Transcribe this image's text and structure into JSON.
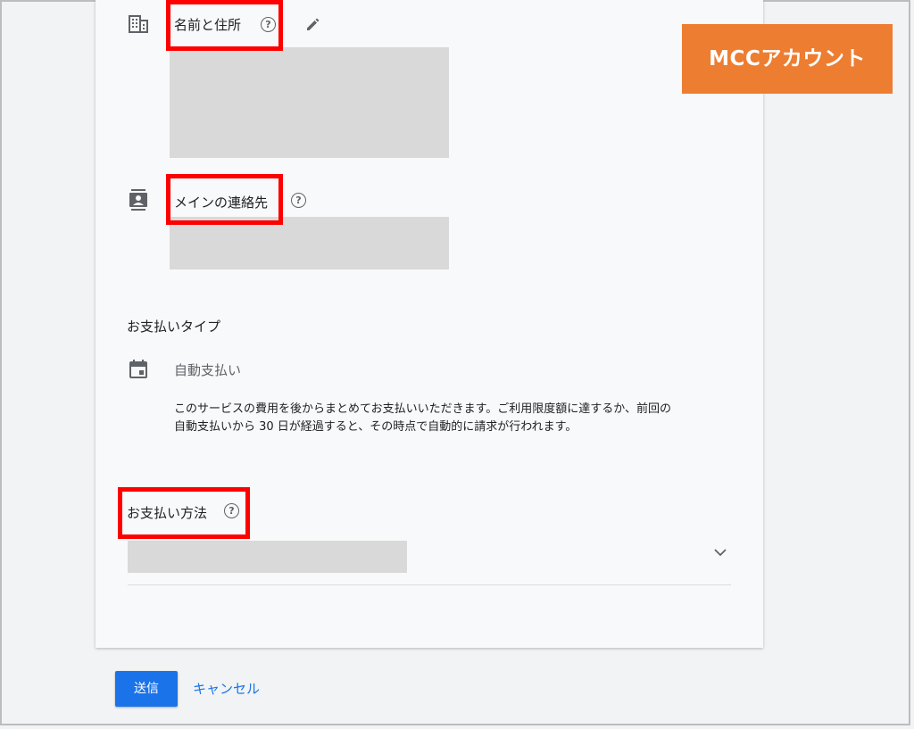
{
  "annotation": {
    "badge_label": "MCCアカウント",
    "badge_color": "#ed7d31",
    "highlight_color": "#ff0000"
  },
  "sections": {
    "name_address": {
      "label": "名前と住所",
      "icon": "building-icon",
      "help_glyph": "?",
      "edit_icon": "pencil-icon"
    },
    "main_contact": {
      "label": "メインの連絡先",
      "icon": "contact-card-icon",
      "help_glyph": "?"
    },
    "payment_type": {
      "heading": "お支払いタイプ",
      "icon": "calendar-icon",
      "value": "自動支払い",
      "description_line1": "このサービスの費用を後からまとめてお支払いいただきます。ご利用限度額に達するか、前回の",
      "description_line2": "自動支払いから 30 日が経過すると、その時点で自動的に請求が行われます。"
    },
    "payment_method": {
      "label": "お支払い方法",
      "help_glyph": "?",
      "dropdown_icon": "chevron-down-icon"
    }
  },
  "actions": {
    "submit_label": "送信",
    "cancel_label": "キャンセル"
  },
  "colors": {
    "accent": "#1a73e8"
  }
}
